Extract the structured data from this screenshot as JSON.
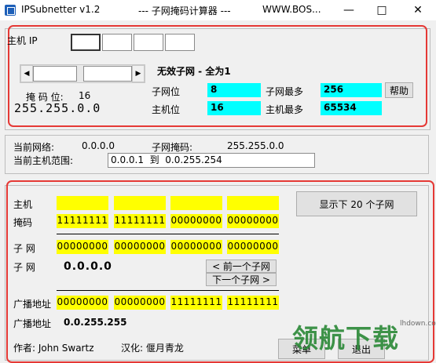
{
  "window": {
    "title": "IPSubnetter v1.2",
    "subtitle": "--- 子网掩码计算器 ---",
    "url": "WWW.BOS..."
  },
  "ip_panel": {
    "ip_label": "主机 IP",
    "mask_bits_label": "掩 码 位:",
    "mask_bits_value": "16",
    "mask_text": "255.255.0.0",
    "status_title": "无效子网 - 全为1",
    "subnet_bits_label": "子网位",
    "subnet_bits_value": "8",
    "max_subnets_label": "子网最多",
    "max_subnets_value": "256",
    "host_bits_label": "主机位",
    "host_bits_value": "16",
    "max_hosts_label": "主机最多",
    "max_hosts_value": "65534",
    "help_label": "帮助"
  },
  "current": {
    "network_label": "当前网络:",
    "network_value": "0.0.0.0",
    "mask_label": "子网掩码:",
    "mask_value": "255.255.0.0",
    "range_label": "当前主机范围:",
    "range_value": "0.0.0.1  到  0.0.255.254"
  },
  "binary": {
    "host_label": "主机",
    "mask_label": "掩码",
    "mask_octets": [
      "11111111",
      "11111111",
      "00000000",
      "00000000"
    ],
    "subnet_label": "子 网",
    "subnet_octets": [
      "00000000",
      "00000000",
      "00000000",
      "00000000"
    ],
    "subnet2_label": "子 网",
    "subnet_value": "0.0.0.0",
    "prev_subnet": "< 前一个子网",
    "next_subnet": "下一个子网 >",
    "broadcast_label": "广播地址",
    "broadcast_octets": [
      "00000000",
      "00000000",
      "11111111",
      "11111111"
    ],
    "broadcast2_label": "广播地址",
    "broadcast_value": "0.0.255.255",
    "show_subnets_button": "显示下 20 个子网"
  },
  "footer": {
    "author": "作者: John Swartz",
    "translation": "汉化: 偃月青龙",
    "menu_button": "菜单",
    "exit_button": "退出"
  },
  "watermark": {
    "text": "领航下载",
    "url": "lhdown.com"
  },
  "colors": {
    "cyan": "#00ffff",
    "yellow": "#ffff00",
    "highlight_border": "#e53935"
  }
}
